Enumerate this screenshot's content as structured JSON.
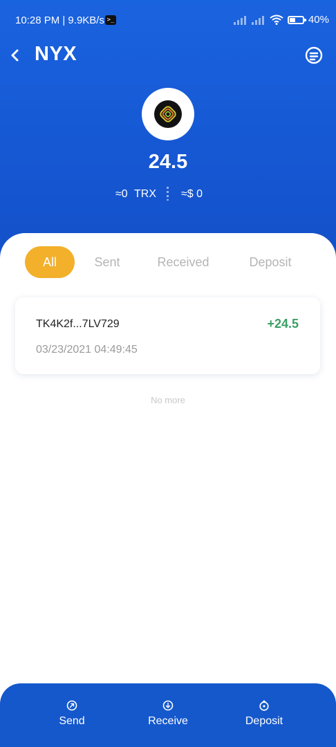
{
  "status_bar": {
    "time": "10:28 PM | 9.9KB/s",
    "terminal_glyph": ">_",
    "battery": "40%"
  },
  "header": {
    "title": "NYX",
    "back_icon": "chevron-left-icon",
    "menu_icon": "menu-circle-icon"
  },
  "token": {
    "logo_icon": "nyx-token-logo",
    "balance": "24.5",
    "trx_value": "≈0",
    "trx_unit": "TRX",
    "usd_value": "≈$ 0"
  },
  "tabs": [
    {
      "label": "All",
      "active": true
    },
    {
      "label": "Sent",
      "active": false
    },
    {
      "label": "Received",
      "active": false
    },
    {
      "label": "Deposit",
      "active": false
    }
  ],
  "transactions": [
    {
      "address": "TK4K2f...7LV729",
      "amount": "+24.5",
      "date": "03/23/2021 04:49:45"
    }
  ],
  "list_end_text": "No more",
  "bottom_bar": {
    "send": "Send",
    "receive": "Receive",
    "deposit": "Deposit"
  },
  "colors": {
    "header_blue": "#1a63df",
    "active_tab": "#f2b02b",
    "positive_amount": "#3aa065",
    "bottom_bar": "#1558cc"
  }
}
